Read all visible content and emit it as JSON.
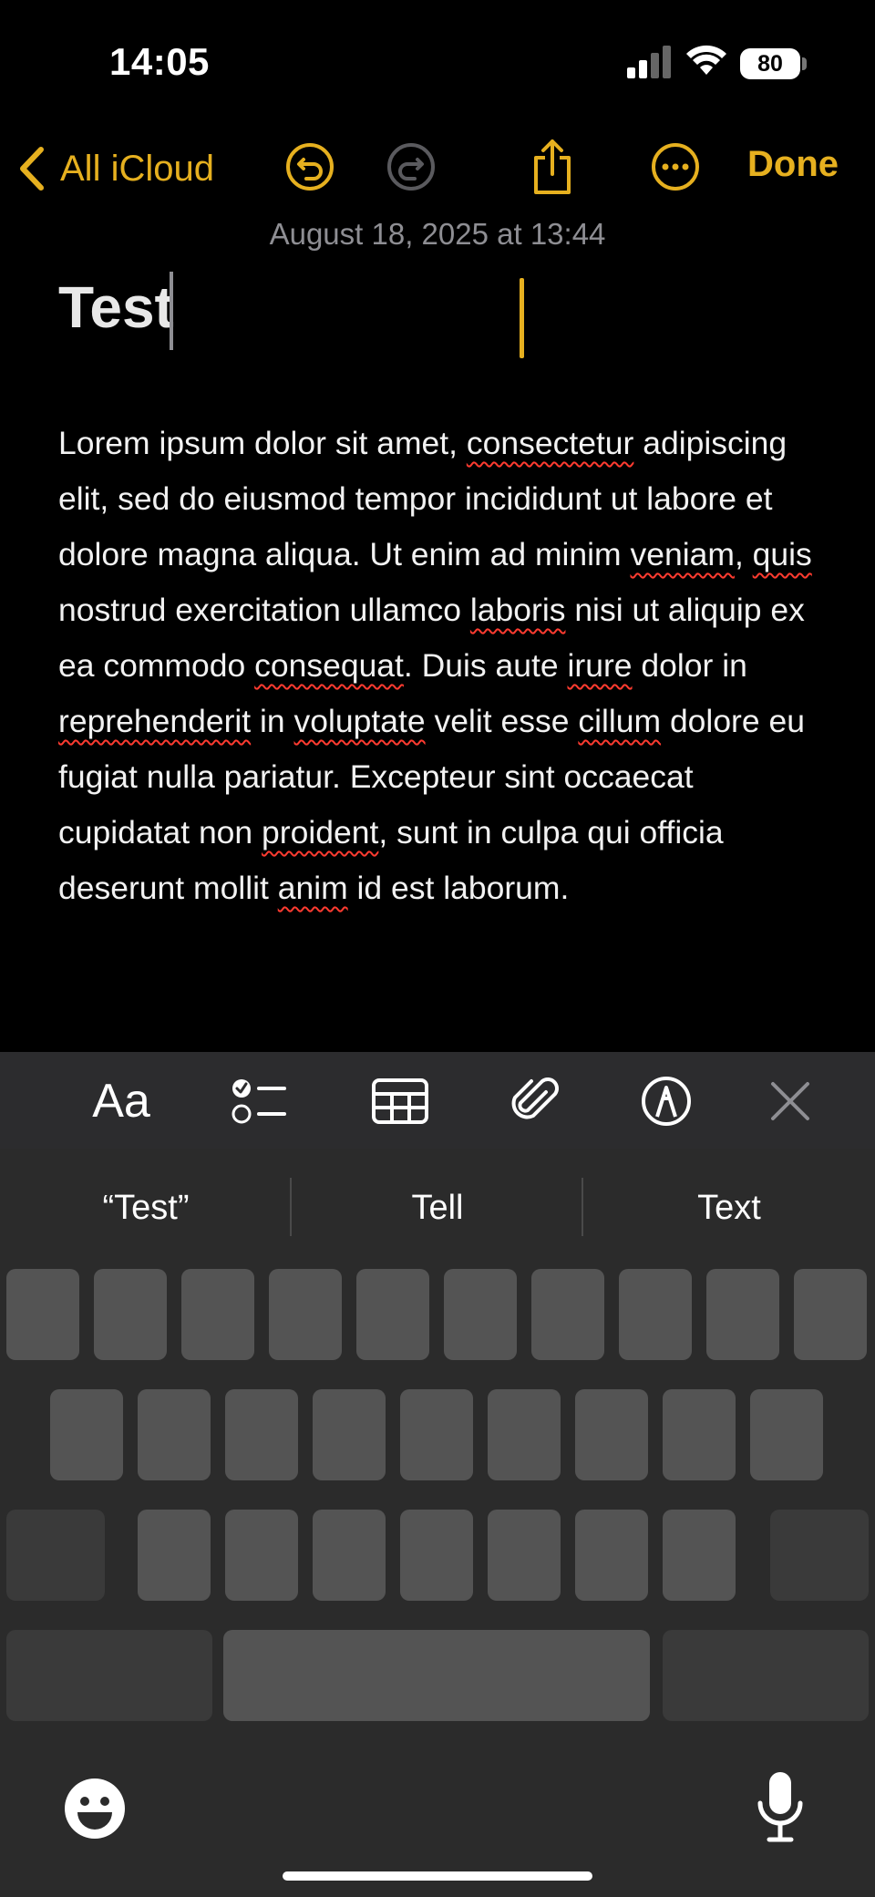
{
  "status": {
    "time": "14:05",
    "battery": "80"
  },
  "toolbar": {
    "back_label": "All iCloud",
    "done_label": "Done"
  },
  "note": {
    "date": "August 18, 2025 at 13:44",
    "title": "Test",
    "body": [
      {
        "t": "Lorem ipsum dolor sit amet, "
      },
      {
        "t": "consectetur",
        "s": true
      },
      {
        "t": " adipiscing elit, sed do eiusmod tempor incididunt ut labore et dolore magna aliqua. Ut enim ad minim "
      },
      {
        "t": "veniam",
        "s": true
      },
      {
        "t": ", "
      },
      {
        "t": "quis",
        "s": true
      },
      {
        "t": " nostrud exercitation ullamco "
      },
      {
        "t": "laboris",
        "s": true
      },
      {
        "t": " nisi ut aliquip ex ea commodo "
      },
      {
        "t": "consequat",
        "s": true
      },
      {
        "t": ". Duis aute "
      },
      {
        "t": "irure",
        "s": true
      },
      {
        "t": " dolor in "
      },
      {
        "t": "reprehenderit",
        "s": true
      },
      {
        "t": " in "
      },
      {
        "t": "voluptate",
        "s": true
      },
      {
        "t": " velit esse "
      },
      {
        "t": "cillum",
        "s": true
      },
      {
        "t": " dolore eu fugiat nulla pariatur. Excepteur sint occaecat cupidatat non "
      },
      {
        "t": "proident",
        "s": true
      },
      {
        "t": ", sunt in culpa qui officia deserunt mollit "
      },
      {
        "t": "anim",
        "s": true
      },
      {
        "t": " id est laborum."
      }
    ]
  },
  "format_bar": {
    "text_style_label": "Aa"
  },
  "keyboard": {
    "suggestions": [
      "“Test”",
      "Tell",
      "Text"
    ]
  },
  "colors": {
    "accent": "#e6b01f",
    "spell": "#ff3b30",
    "keyboard_bg": "#2b2b2b",
    "key": "#545454"
  },
  "icons": [
    "chevron-left-icon",
    "undo-icon",
    "redo-icon",
    "share-icon",
    "more-icon",
    "checklist-icon",
    "table-icon",
    "paperclip-icon",
    "markup-icon",
    "close-icon",
    "emoji-icon",
    "microphone-icon"
  ]
}
